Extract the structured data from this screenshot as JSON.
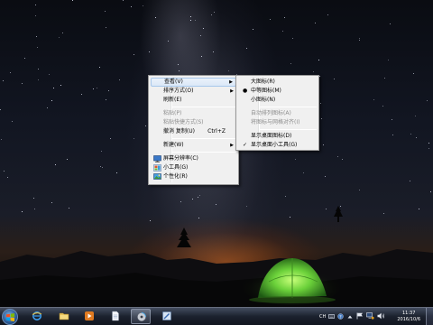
{
  "context_menu": {
    "items": [
      {
        "label": "查看(V)",
        "submenu": true,
        "highlighted": true
      },
      {
        "label": "排序方式(O)",
        "submenu": true
      },
      {
        "label": "刷新(E)"
      },
      {
        "separator": true
      },
      {
        "label": "粘贴(P)",
        "disabled": true
      },
      {
        "label": "粘贴快捷方式(S)",
        "disabled": true
      },
      {
        "label": "撤消 复制(U)",
        "shortcut": "Ctrl+Z"
      },
      {
        "separator": true
      },
      {
        "label": "新建(W)",
        "submenu": true
      },
      {
        "separator": true
      },
      {
        "label": "屏幕分辨率(C)",
        "icon": "screen-resolution-icon"
      },
      {
        "label": "小工具(G)",
        "icon": "gadgets-icon"
      },
      {
        "label": "个性化(R)",
        "icon": "personalize-icon"
      }
    ]
  },
  "view_submenu": {
    "items": [
      {
        "label": "大图标(R)"
      },
      {
        "label": "中等图标(M)",
        "mark": "●"
      },
      {
        "label": "小图标(N)"
      },
      {
        "separator": true
      },
      {
        "label": "自动排列图标(A)",
        "disabled": true
      },
      {
        "label": "将图标与网格对齐(I)",
        "disabled": true
      },
      {
        "separator": true
      },
      {
        "label": "显示桌面图标(D)"
      },
      {
        "label": "显示桌面小工具(G)",
        "mark": "✓"
      }
    ]
  },
  "taskbar": {
    "pinned": [
      {
        "name": "internet-explorer-icon",
        "active": false
      },
      {
        "name": "file-explorer-icon",
        "active": false
      },
      {
        "name": "media-player-icon",
        "active": false
      },
      {
        "name": "document-icon",
        "active": false
      },
      {
        "name": "disc-app-icon",
        "active": true
      },
      {
        "name": "tool-app-icon",
        "active": false
      }
    ],
    "tray": {
      "language": "CH",
      "time": "11:37",
      "date": "2016/10/6"
    }
  },
  "colors": {
    "menu_bg": "#f0f0f0",
    "highlight": "#dbe8f7",
    "tent": "#6bd13a",
    "glow": "#e66e1e"
  }
}
